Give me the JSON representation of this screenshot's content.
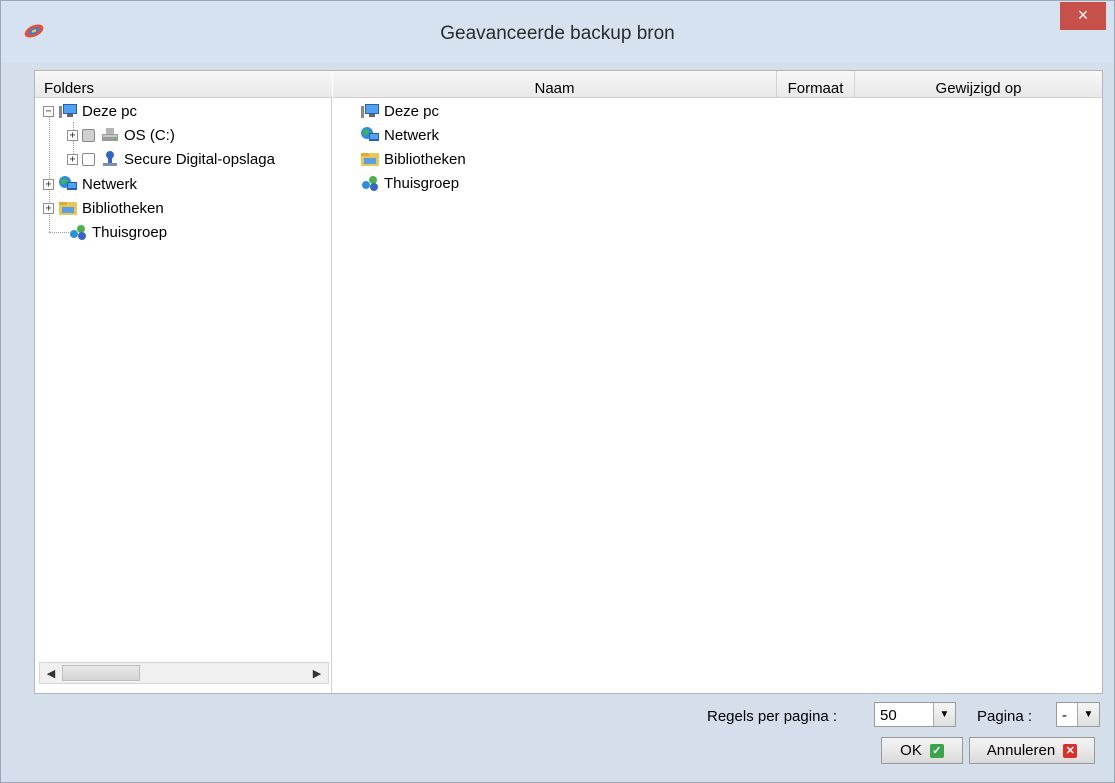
{
  "window": {
    "title": "Geavanceerde backup bron",
    "close_label": "×"
  },
  "folders_panel": {
    "header": "Folders",
    "tree": [
      {
        "label": "Deze pc",
        "icon": "computer-icon",
        "expander": "−"
      },
      {
        "label": "OS (C:)",
        "icon": "drive-icon",
        "expander": "+"
      },
      {
        "label": "Secure Digital-opslaga",
        "icon": "removable-storage-icon",
        "expander": "+"
      },
      {
        "label": "Netwerk",
        "icon": "network-icon",
        "expander": "+"
      },
      {
        "label": "Bibliotheken",
        "icon": "libraries-icon",
        "expander": "+"
      },
      {
        "label": "Thuisgroep",
        "icon": "homegroup-icon",
        "expander": ""
      }
    ]
  },
  "file_list": {
    "columns": [
      "Naam",
      "Formaat",
      "Gewijzigd op"
    ],
    "rows": [
      {
        "name": "Deze pc",
        "icon": "computer-icon"
      },
      {
        "name": "Netwerk",
        "icon": "network-icon"
      },
      {
        "name": "Bibliotheken",
        "icon": "libraries-icon"
      },
      {
        "name": "Thuisgroep",
        "icon": "homegroup-icon"
      }
    ]
  },
  "pager": {
    "rows_per_page_label": "Regels per pagina :",
    "rows_per_page_value": "50",
    "page_label": "Pagina :",
    "page_value": "-"
  },
  "buttons": {
    "ok_label": "OK",
    "cancel_label": "Annuleren"
  },
  "colors": {
    "accent_close": "#c7504b",
    "ok_badge": "#3aa54a",
    "cancel_badge": "#d9302a"
  }
}
